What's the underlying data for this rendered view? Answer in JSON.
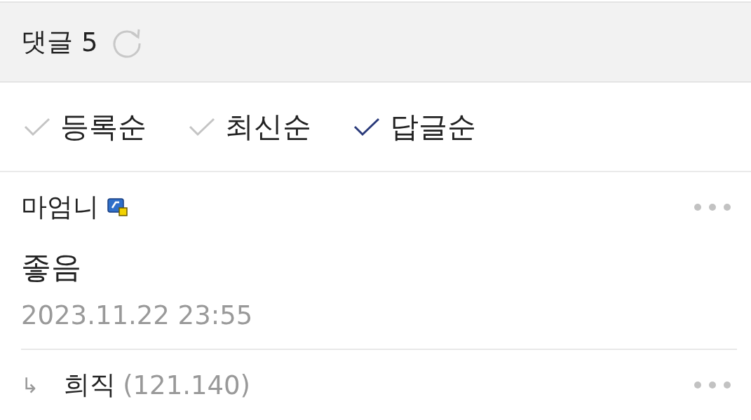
{
  "header": {
    "title": "댓글",
    "count": "5"
  },
  "sort_options": [
    {
      "label": "등록순",
      "selected": false
    },
    {
      "label": "최신순",
      "selected": false
    },
    {
      "label": "답글순",
      "selected": true
    }
  ],
  "comments": [
    {
      "kind": "comment",
      "author": "마엄니",
      "badge": true,
      "text": "좋음",
      "date": "2023.11.22 23:55"
    },
    {
      "kind": "reply",
      "reply_mark": "↳",
      "author": "희직",
      "badge": false,
      "ip": "(121.140)"
    }
  ]
}
